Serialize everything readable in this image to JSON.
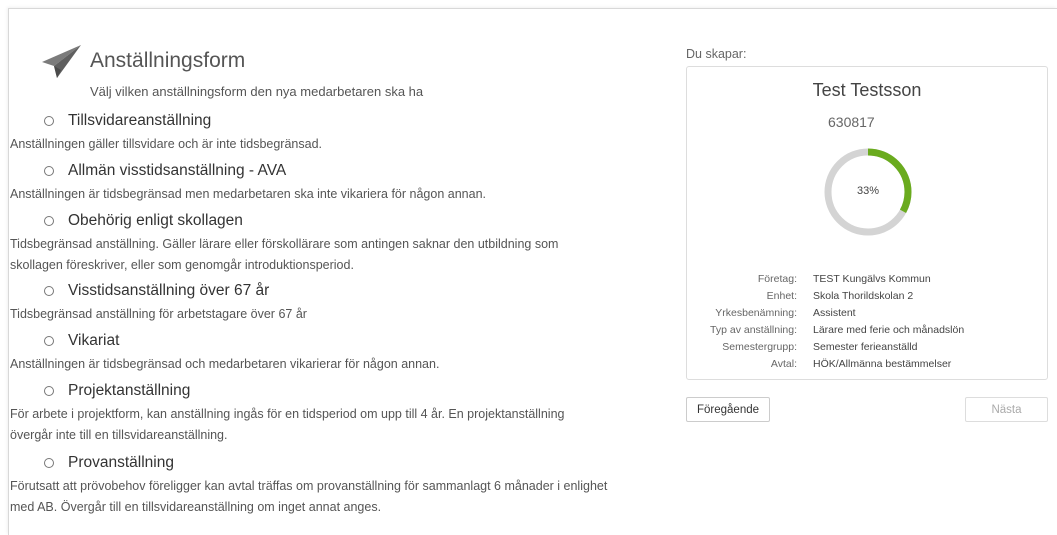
{
  "header": {
    "title": "Anställningsform",
    "subtitle": "Välj vilken anställningsform den nya medarbetaren ska ha",
    "icon": "paper-plane-icon"
  },
  "options": [
    {
      "label": "Tillsvidareanställning",
      "description": "Anställningen gäller tillsvidare och är inte tidsbegränsad."
    },
    {
      "label": "Allmän visstidsanställning - AVA",
      "description": "Anställningen är tidsbegränsad men medarbetaren ska inte vikariera för någon annan."
    },
    {
      "label": "Obehörig enligt skollagen",
      "description": "Tidsbegränsad anställning. Gäller lärare eller förskollärare som antingen saknar den utbildning som skollagen föreskriver, eller som genomgår introduktionsperiod."
    },
    {
      "label": "Visstidsanställning över 67 år",
      "description": "Tidsbegränsad anställning för arbetstagare över 67 år"
    },
    {
      "label": "Vikariat",
      "description": "Anställningen är tidsbegränsad och medarbetaren vikarierar för någon annan."
    },
    {
      "label": "Projektanställning",
      "description": "För arbete i projektform, kan anställning ingås för en tidsperiod om upp till 4 år. En projektanställning övergår inte till en tillsvidareanställning."
    },
    {
      "label": "Provanställning",
      "description": "Förutsatt att prövobehov föreligger kan avtal träffas om provanställning för sammanlagt 6 månader i enlighet med AB. Övergår till en tillsvidareanställning om inget annat anges."
    }
  ],
  "summary": {
    "creating_label": "Du skapar:",
    "name": "Test Testsson",
    "number": "630817",
    "progress_percent": 33,
    "progress_label": "33%",
    "progress_color": "#6aab1e",
    "track_color": "#d4d4d4",
    "details": [
      {
        "key": "Företag:",
        "value": "TEST Kungälvs Kommun"
      },
      {
        "key": "Enhet:",
        "value": "Skola Thorildskolan 2"
      },
      {
        "key": "Yrkesbenämning:",
        "value": "Assistent"
      },
      {
        "key": "Typ av anställning:",
        "value": "Lärare med ferie och månadslön"
      },
      {
        "key": "Semestergrupp:",
        "value": "Semester ferieanställd"
      },
      {
        "key": "Avtal:",
        "value": "HÖK/Allmänna bestämmelser"
      }
    ]
  },
  "nav": {
    "prev_label": "Föregående",
    "next_label": "Nästa"
  }
}
